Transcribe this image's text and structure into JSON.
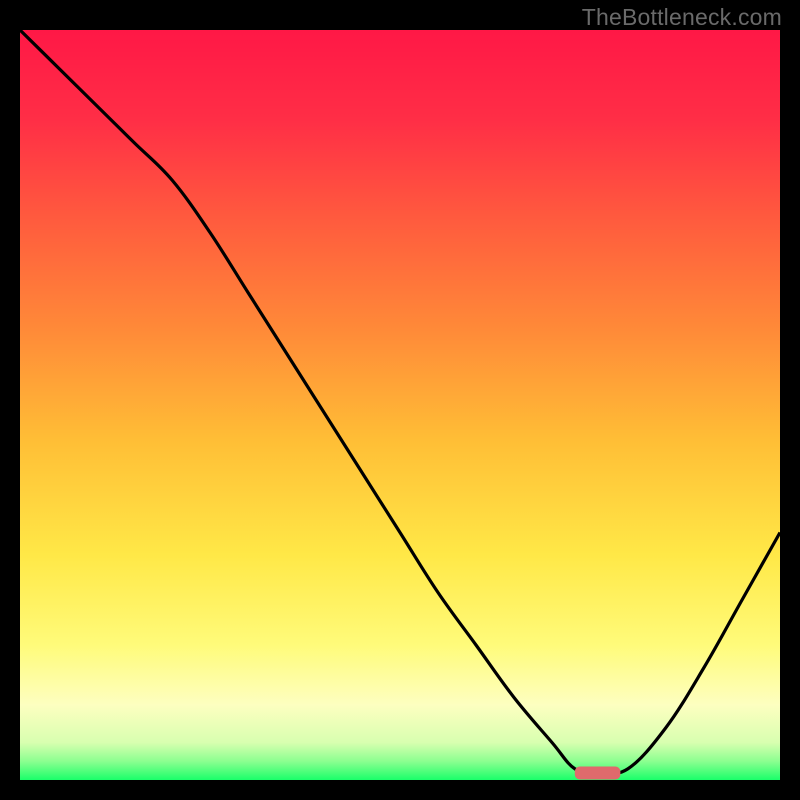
{
  "watermark": "TheBottleneck.com",
  "colors": {
    "frame": "#000000",
    "line": "#000000",
    "marker": "#e06a6c",
    "gradient_stops": [
      {
        "offset": 0.0,
        "color": "#ff1846"
      },
      {
        "offset": 0.12,
        "color": "#ff2e46"
      },
      {
        "offset": 0.25,
        "color": "#ff5a3e"
      },
      {
        "offset": 0.4,
        "color": "#ff8a38"
      },
      {
        "offset": 0.55,
        "color": "#ffbf36"
      },
      {
        "offset": 0.7,
        "color": "#ffe847"
      },
      {
        "offset": 0.82,
        "color": "#fffb7a"
      },
      {
        "offset": 0.9,
        "color": "#fdffc0"
      },
      {
        "offset": 0.95,
        "color": "#d8ffb0"
      },
      {
        "offset": 0.975,
        "color": "#8cff90"
      },
      {
        "offset": 1.0,
        "color": "#1aff6a"
      }
    ]
  },
  "chart_data": {
    "type": "line",
    "title": "",
    "xlabel": "",
    "ylabel": "",
    "xlim": [
      0,
      100
    ],
    "ylim": [
      0,
      100
    ],
    "x": [
      0,
      5,
      10,
      15,
      20,
      25,
      30,
      35,
      40,
      45,
      50,
      55,
      60,
      65,
      70,
      73,
      76,
      80,
      85,
      90,
      95,
      100
    ],
    "values": [
      100,
      95,
      90,
      85,
      80,
      73,
      65,
      57,
      49,
      41,
      33,
      25,
      18,
      11,
      5,
      1.5,
      1,
      1.5,
      7,
      15,
      24,
      33
    ],
    "baseline_flat_range_x": [
      72.5,
      78
    ],
    "marker": {
      "x_start": 73,
      "x_end": 79,
      "y": 1
    }
  }
}
